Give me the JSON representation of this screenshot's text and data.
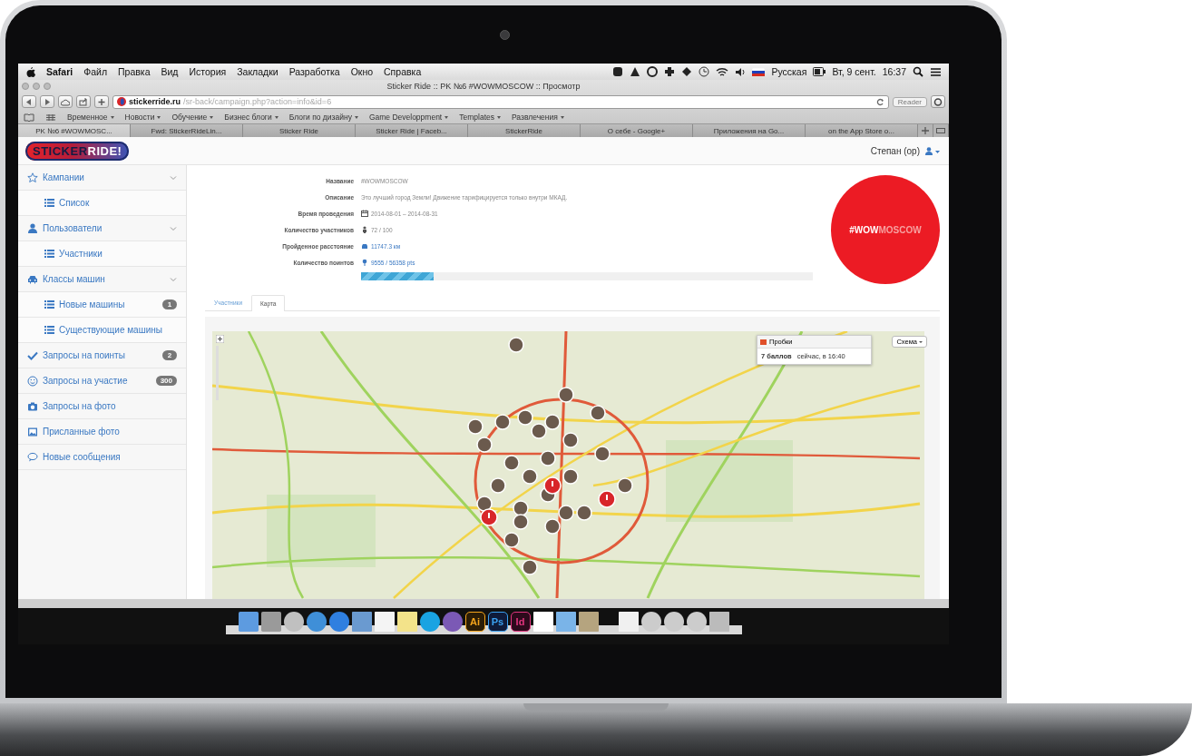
{
  "menu_bar": {
    "app": "Safari",
    "menus": [
      "Файл",
      "Правка",
      "Вид",
      "История",
      "Закладки",
      "Разработка",
      "Окно",
      "Справка"
    ],
    "input_source": "Русская",
    "date": "Вт, 9 сент.",
    "time": "16:37"
  },
  "browser": {
    "title": "Sticker Ride :: PK №6 #WOWMOSCOW :: Просмотр",
    "url_host": "stickerride.ru",
    "url_path": "/sr-back/campaign.php?action=info&id=6",
    "reader": {
      "label": "Reader",
      "disabled": true
    },
    "bookmarks": [
      "Временное",
      "Новости",
      "Обучение",
      "Бизнес блоги",
      "Блоги по дизайну",
      "Game Developpment",
      "Templates",
      "Развлечения"
    ],
    "tabs": [
      {
        "label": "PK №6 #WOWMOSC...",
        "selected": true
      },
      {
        "label": "Fwd: StickerRideLin...",
        "selected": false
      },
      {
        "label": "Sticker Ride",
        "selected": false
      },
      {
        "label": "Sticker Ride | Faceb...",
        "selected": false
      },
      {
        "label": "StickerRide",
        "selected": false
      },
      {
        "label": "О себе - Google+",
        "selected": false
      },
      {
        "label": "Приложения на Go...",
        "selected": false
      },
      {
        "label": "on the App Store o...",
        "selected": false
      }
    ]
  },
  "header": {
    "logo_left": "STICKER",
    "logo_right": "RIDE!",
    "user": "Степан (ор)"
  },
  "sidebar": {
    "items": [
      {
        "label": "Кампании",
        "expanded": true,
        "children": [
          {
            "label": "Список"
          }
        ]
      },
      {
        "label": "Пользователи",
        "expanded": true,
        "children": [
          {
            "label": "Участники"
          }
        ]
      },
      {
        "label": "Классы машин",
        "expanded": true,
        "children": [
          {
            "label": "Новые машины",
            "count": "1"
          },
          {
            "label": "Существующие машины"
          }
        ]
      },
      {
        "label": "Запросы на поинты",
        "count": "2"
      },
      {
        "label": "Запросы на участие",
        "count": "300"
      },
      {
        "label": "Запросы на фото"
      },
      {
        "label": "Присланные фото"
      },
      {
        "label": "Новые сообщения"
      }
    ]
  },
  "campaign": {
    "fields": [
      {
        "label": "Название",
        "value": "#WOWMOSCOW",
        "kind": "text"
      },
      {
        "label": "Описание",
        "value": "Это лучший город Земли! Движение тарифицируется только внутри МКАД.",
        "kind": "text"
      },
      {
        "label": "Время проведения",
        "value": "2014-08-01 – 2014-08-31",
        "kind": "text"
      },
      {
        "label": "Количество участников",
        "value": "72 / 100",
        "kind": "text"
      },
      {
        "label": "Пройденное расстояние",
        "value": "11747.3 км",
        "kind": "link"
      },
      {
        "label": "Количество поинтов",
        "value": "9555 / 56358 pts",
        "kind": "link",
        "level": 0.16
      }
    ],
    "badge": {
      "left": "#WOW",
      "right": "MOSCOW"
    }
  },
  "content_tabs": [
    {
      "label": "Участники",
      "selected": false
    },
    {
      "label": "Карта",
      "selected": true
    }
  ],
  "map": {
    "traffic": {
      "title": "Пробки",
      "score": "7 баллов",
      "time": "сейчас, в 16:40"
    },
    "layer_button": "Схема"
  },
  "dock": {
    "lettered_apps": [
      "Ai",
      "Ps",
      "Id"
    ]
  }
}
